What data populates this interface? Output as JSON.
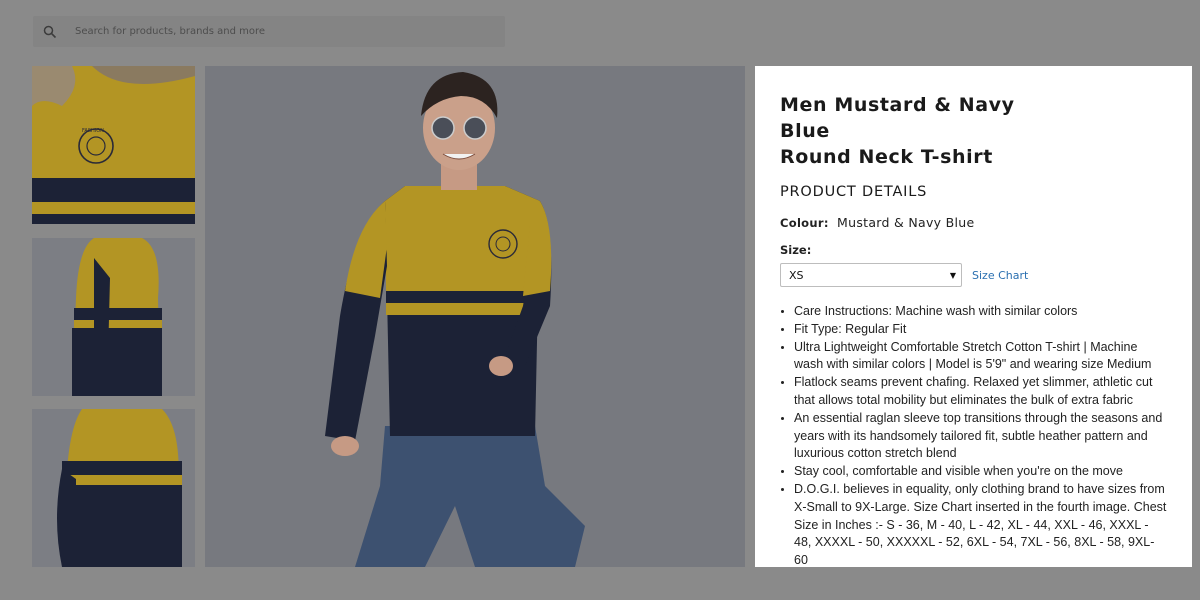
{
  "search": {
    "placeholder": "Search for products, brands and more",
    "icon": "search-icon"
  },
  "gallery": {
    "thumbnails": [
      {
        "alt": "chest logo close-up"
      },
      {
        "alt": "side view"
      },
      {
        "alt": "back view"
      }
    ],
    "main_alt": "model wearing mustard and navy t-shirt",
    "colors": {
      "mustard": "#b89a1e",
      "navy": "#1c2236",
      "denim": "#3a4d6b"
    }
  },
  "product": {
    "title_line1": "Men Mustard & Navy Blue",
    "title_line2": "Round Neck T-shirt",
    "details_heading": "PRODUCT DETAILS",
    "colour_label": "Colour:",
    "colour_value": "Mustard & Navy Blue",
    "size_label": "Size:",
    "size_selected": "XS",
    "size_chart_link": "Size Chart",
    "features": [
      "Care Instructions: Machine wash with similar colors",
      "Fit Type: Regular Fit",
      "Ultra Lightweight Comfortable Stretch Cotton T-shirt | Machine wash with similar colors | Model is 5'9\" and wearing size Medium",
      "Flatlock seams prevent chafing. Relaxed yet slimmer, athletic cut that allows total mobility but eliminates the bulk of extra fabric",
      "An essential raglan sleeve top transitions through the seasons and years with its handsomely tailored fit, subtle heather pattern and luxurious cotton stretch blend",
      "Stay cool, comfortable and visible when you're on the move",
      "D.O.G.I. believes in equality, only clothing brand to have sizes from X-Small to 9X-Large. Size Chart inserted in the fourth image. Chest Size in Inches :- S - 36, M - 40, L - 42, XL - 44, XXL - 46, XXXL - 48, XXXXL - 50, XXXXXL - 52, 6XL - 54, 7XL - 56, 8XL - 58, 9XL- 60"
    ]
  },
  "logo_text": "FASHION STITCHERY"
}
